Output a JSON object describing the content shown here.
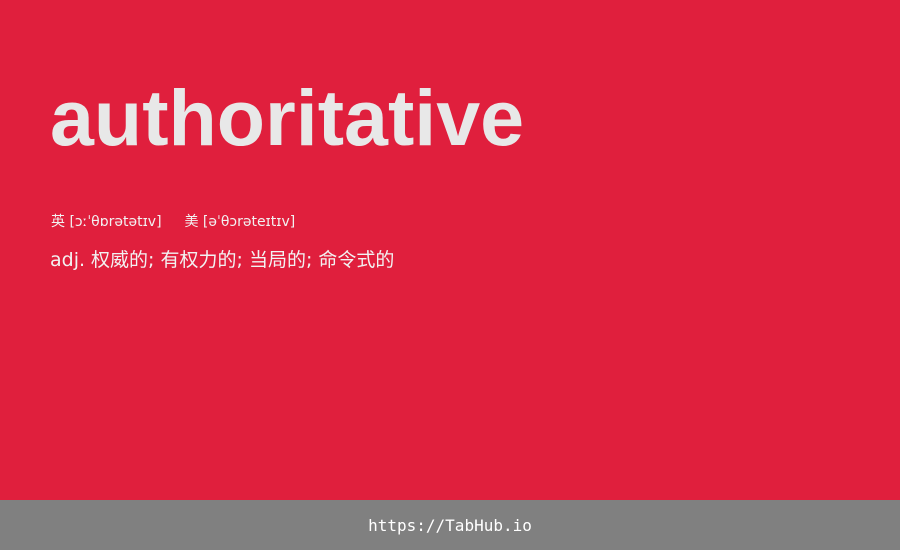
{
  "word": "authoritative",
  "phonetics": {
    "uk_label": "英",
    "uk_ipa": "[ɔːˈθɒrətətɪv]",
    "us_label": "美",
    "us_ipa": "[əˈθɔrəteɪtɪv]"
  },
  "definition": "adj. 权威的; 有权力的; 当局的; 命令式的",
  "footer": {
    "link": "https://TabHub.io"
  },
  "colors": {
    "background": "#e01f3d",
    "word_text": "#e8e8e8",
    "footer_bg": "#808080"
  }
}
